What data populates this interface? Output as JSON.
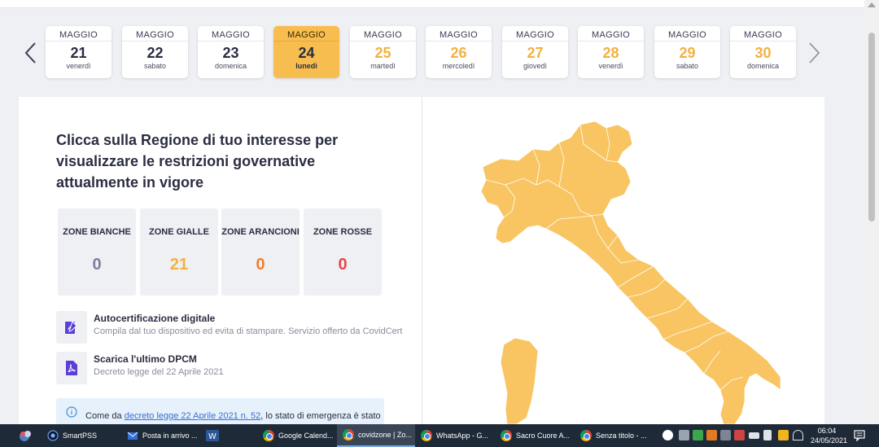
{
  "calendar": {
    "prev_icon": "chevron-left-icon",
    "next_icon": "chevron-right-icon",
    "days": [
      {
        "month": "MAGGIO",
        "day": "21",
        "weekday": "venerdì",
        "state": "past"
      },
      {
        "month": "MAGGIO",
        "day": "22",
        "weekday": "sabato",
        "state": "past"
      },
      {
        "month": "MAGGIO",
        "day": "23",
        "weekday": "domenica",
        "state": "past"
      },
      {
        "month": "MAGGIO",
        "day": "24",
        "weekday": "lunedì",
        "state": "active"
      },
      {
        "month": "MAGGIO",
        "day": "25",
        "weekday": "martedì",
        "state": "future"
      },
      {
        "month": "MAGGIO",
        "day": "26",
        "weekday": "mercoledì",
        "state": "future"
      },
      {
        "month": "MAGGIO",
        "day": "27",
        "weekday": "giovedì",
        "state": "future"
      },
      {
        "month": "MAGGIO",
        "day": "28",
        "weekday": "venerdì",
        "state": "future"
      },
      {
        "month": "MAGGIO",
        "day": "29",
        "weekday": "sabato",
        "state": "future"
      },
      {
        "month": "MAGGIO",
        "day": "30",
        "weekday": "domenica",
        "state": "future"
      }
    ]
  },
  "main": {
    "headline": "Clicca sulla Regione di tuo interesse per visualizzare le restrizioni governative attualmente in vigore",
    "zones": [
      {
        "label": "ZONE BIANCHE",
        "value": "0",
        "color": "#7b7f9e"
      },
      {
        "label": "ZONE GIALLE",
        "value": "21",
        "color": "#f3b13e"
      },
      {
        "label": "ZONE ARANCIONI",
        "value": "0",
        "color": "#f07f2e"
      },
      {
        "label": "ZONE ROSSE",
        "value": "0",
        "color": "#e5484d"
      }
    ],
    "autocert": {
      "icon": "edit-document-icon",
      "title": "Autocertificazione digitale",
      "subtitle": "Compila dal tuo dispositivo ed evita di stampare. Servizio offerto da CovidCert"
    },
    "dpcm": {
      "icon": "pdf-file-icon",
      "title": "Scarica l'ultimo DPCM",
      "subtitle": "Decreto legge del 22 Aprile 2021"
    },
    "info": {
      "icon": "info-icon",
      "text_before": "Come da ",
      "link": "decreto legge 22 Aprile 2021 n. 52",
      "text_after": ", lo stato di emergenza è stato"
    },
    "map_color": "#f8c562",
    "map_border": "#ffffff"
  },
  "taskbar": {
    "items": [
      {
        "label": "SmartPSS",
        "icon": "smartpss-icon"
      },
      {
        "label": "Posta in arrivo ...",
        "icon": "outlook-icon"
      },
      {
        "label": "",
        "icon": "word-icon"
      },
      {
        "label": "Google Calend...",
        "icon": "chrome-icon"
      },
      {
        "label": "covidzone | Zo...",
        "icon": "chrome-icon"
      },
      {
        "label": "WhatsApp - G...",
        "icon": "chrome-icon"
      },
      {
        "label": "Sacro Cuore A...",
        "icon": "chrome-icon"
      },
      {
        "label": "Senza titolo - ...",
        "icon": "chrome-icon"
      }
    ],
    "time": "06:04",
    "date": "24/05/2021"
  }
}
